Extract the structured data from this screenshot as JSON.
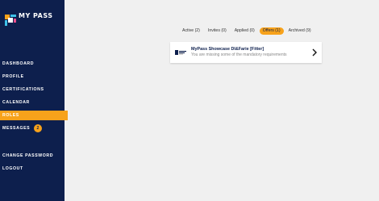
{
  "brand": {
    "name": "MY PASS"
  },
  "sidebar": {
    "items": [
      {
        "label": "DASHBOARD"
      },
      {
        "label": "PROFILE"
      },
      {
        "label": "CERTIFICATIONS"
      },
      {
        "label": "CALENDAR"
      },
      {
        "label": "ROLES",
        "active": true
      },
      {
        "label": "MESSAGES",
        "badge": "2"
      },
      {
        "label": "CHANGE PASSWORD"
      },
      {
        "label": "LOGOUT"
      }
    ]
  },
  "tabs": [
    {
      "label": "Active (2)"
    },
    {
      "label": "Invites (0)"
    },
    {
      "label": "Applied (0)"
    },
    {
      "label": "Offers (1)",
      "active": true
    },
    {
      "label": "Archived (9)"
    }
  ],
  "card": {
    "title": "MyPass Showcase DI&Farie [Fitter]",
    "subtitle": "You are missing some of the mandatory requirements"
  },
  "colors": {
    "sidebar": "#0d1f4d",
    "accent": "#f7a21b",
    "background": "#f0f0f0"
  }
}
